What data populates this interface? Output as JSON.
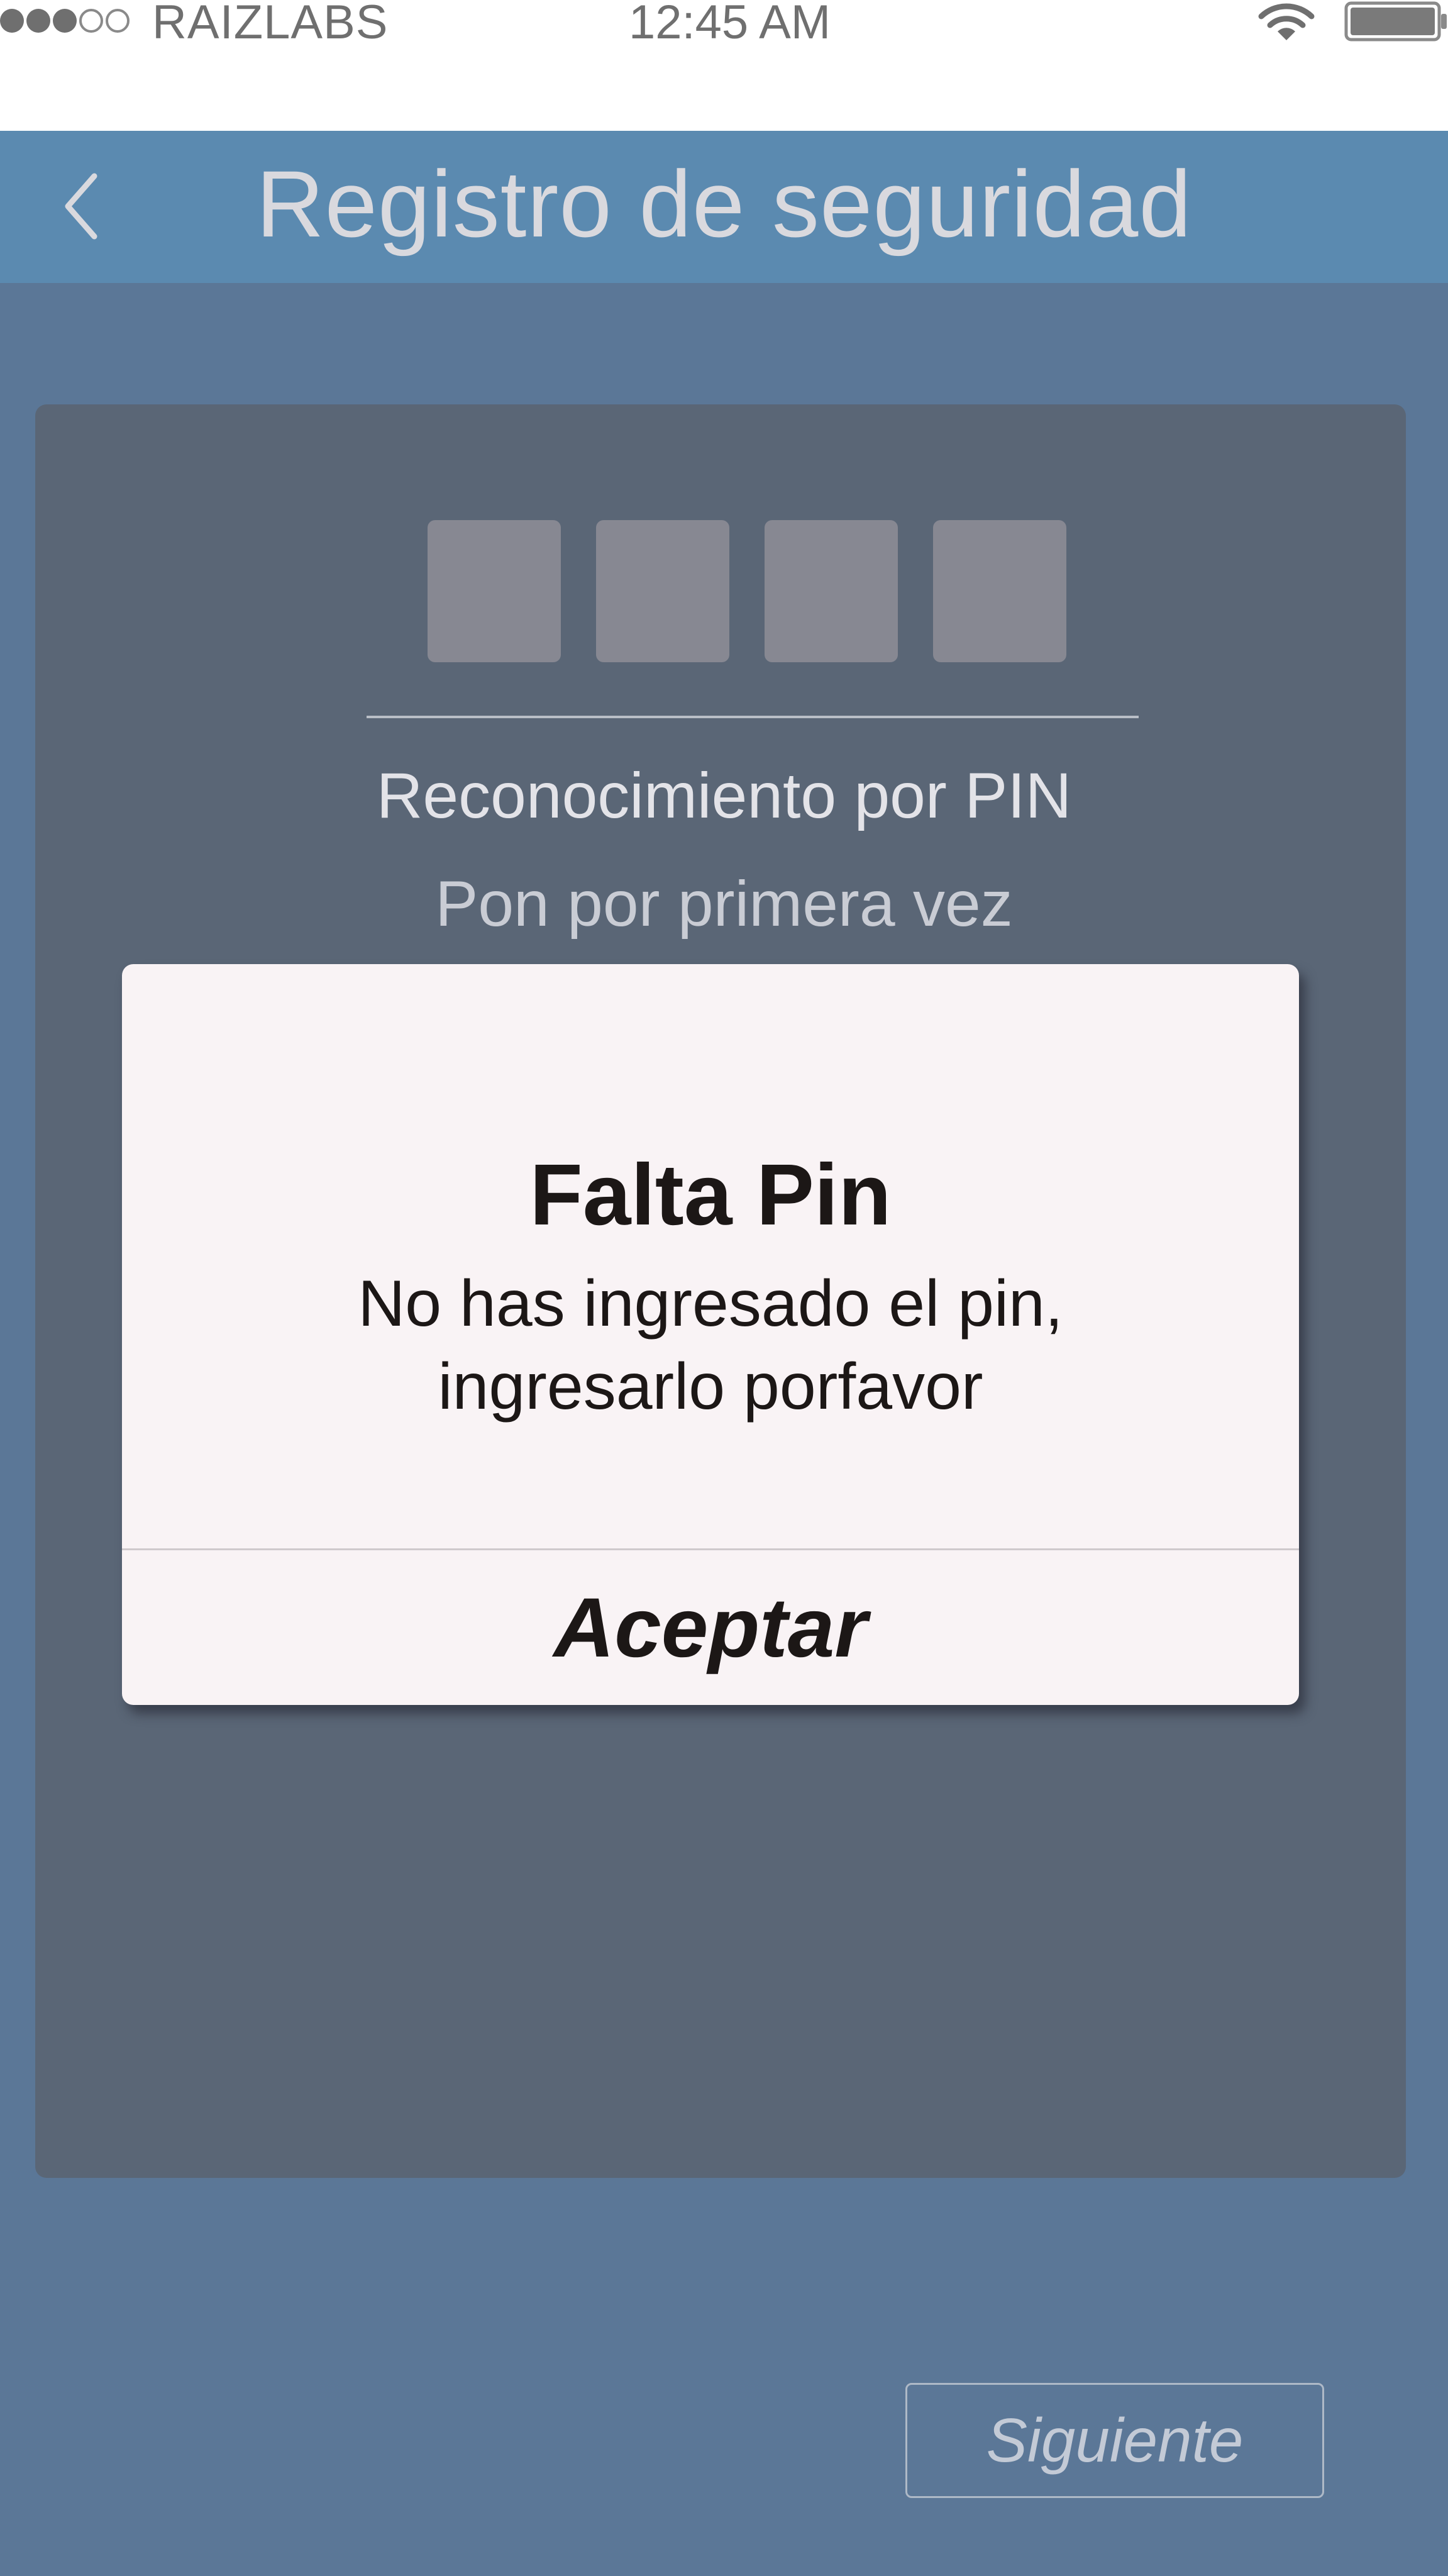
{
  "status_bar": {
    "signal": {
      "filled": 3,
      "total": 5
    },
    "carrier": "RAIZLABS",
    "time": "12:45 AM",
    "icons": [
      "wifi-icon",
      "battery-icon"
    ]
  },
  "header": {
    "back_icon": "chevron-left-icon",
    "title": "Registro de seguridad"
  },
  "pin_section": {
    "box_count": 4,
    "title": "Reconocimiento por PIN",
    "subtitle": "Pon por primera vez"
  },
  "alert": {
    "title": "Falta Pin",
    "message": "No has ingresado  el pin, ingresarlo porfavor",
    "button_label": "Aceptar"
  },
  "footer": {
    "next_label": "Siguiente"
  },
  "colors": {
    "background": "#5b7797",
    "header": "#5b8ab0",
    "card": "#5a6676",
    "pin_box": "#878892",
    "alert_bg": "#f9f3f5",
    "text_dark": "#1c1716"
  }
}
